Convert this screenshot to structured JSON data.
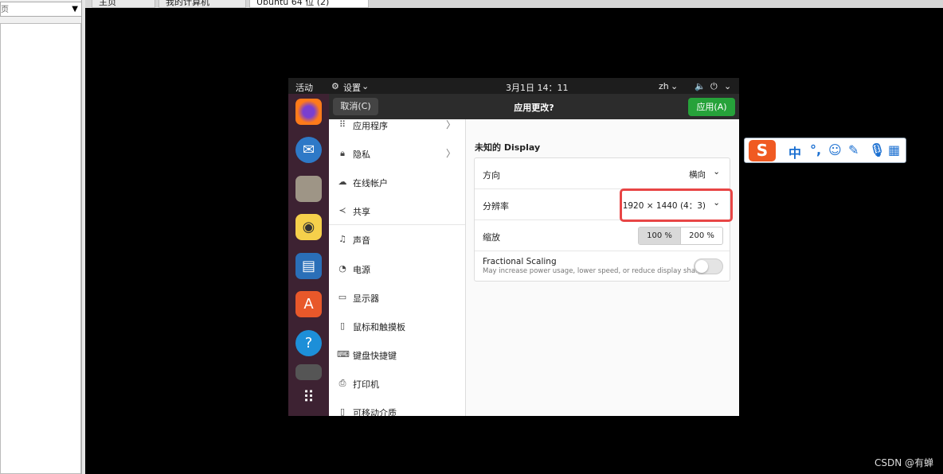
{
  "host": {
    "left_dropdown": "页",
    "tabs": [
      "主页",
      "我的计算机",
      "Ubuntu 64 位 (2)"
    ]
  },
  "topbar": {
    "activities": "活动",
    "app_menu": "设置",
    "clock": "3月1日  14：11",
    "lang": "zh"
  },
  "dock": {
    "apps": [
      "firefox-icon",
      "thunderbird-icon",
      "files-icon",
      "rhythmbox-icon",
      "writer-icon",
      "software-icon",
      "help-icon",
      "disc-icon",
      "show-apps-icon"
    ]
  },
  "header": {
    "cancel": "取消(C)",
    "title": "应用更改?",
    "apply": "应用(A)",
    "apply_color": "#26a23a"
  },
  "sidebar": {
    "items": [
      {
        "icon": "apps-icon",
        "label": "应用程序",
        "chevron": true
      },
      {
        "icon": "lock-icon",
        "label": "隐私",
        "chevron": true
      },
      {
        "icon": "cloud-icon",
        "label": "在线帐户"
      },
      {
        "icon": "share-icon",
        "label": "共享"
      },
      {
        "icon": "music-note-icon",
        "label": "声音"
      },
      {
        "icon": "power-icon",
        "label": "电源"
      },
      {
        "icon": "display-icon",
        "label": "显示器"
      },
      {
        "icon": "mouse-icon",
        "label": "鼠标和触摸板"
      },
      {
        "icon": "keyboard-icon",
        "label": "键盘快捷键"
      },
      {
        "icon": "printer-icon",
        "label": "打印机"
      },
      {
        "icon": "usb-icon",
        "label": "可移动介质"
      }
    ]
  },
  "display": {
    "title": "未知的 Display",
    "orientation": {
      "label": "方向",
      "value": "横向"
    },
    "resolution": {
      "label": "分辨率",
      "value": "1920 × 1440 (4：3)"
    },
    "scale": {
      "label": "缩放",
      "options": [
        "100 %",
        "200 %"
      ],
      "selected": "100 %"
    },
    "fractional": {
      "label": "Fractional Scaling",
      "desc": "May increase power usage, lower speed, or reduce display sharp…",
      "enabled": false
    }
  },
  "ime": {
    "mode": "中",
    "punct": "°,"
  },
  "watermark": "CSDN @有蝉"
}
